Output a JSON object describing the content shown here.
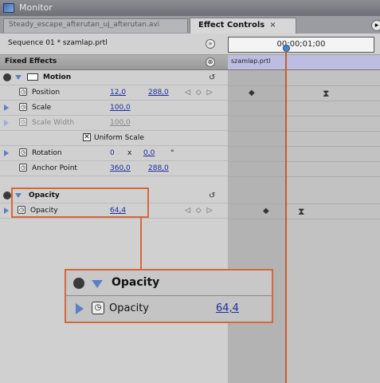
{
  "window": {
    "title": "Monitor"
  },
  "tabs": [
    {
      "label": "Steady_escape_afterutan_uj_afterutan.avi"
    },
    {
      "label": "Effect Controls",
      "close": "×"
    }
  ],
  "header": {
    "sequence": "Sequence 01 * szamlap.prtl",
    "timecode": "00;00;01;00",
    "section": "Fixed Effects",
    "clip_name": "szamlap.prtl"
  },
  "motion": {
    "title": "Motion",
    "position": {
      "label": "Position",
      "x": "12,0",
      "y": "288,0"
    },
    "scale": {
      "label": "Scale",
      "value": "100,0"
    },
    "scale_width": {
      "label": "Scale Width",
      "value": "100,0"
    },
    "uniform_scale": {
      "label": "Uniform Scale",
      "checked": true
    },
    "rotation": {
      "label": "Rotation",
      "turns": "0",
      "x": "x",
      "degrees": "0,0",
      "unit": "°"
    },
    "anchor_point": {
      "label": "Anchor Point",
      "x": "360,0",
      "y": "288,0"
    }
  },
  "opacity": {
    "title": "Opacity",
    "param": {
      "label": "Opacity",
      "value": "64,4"
    }
  },
  "callout": {
    "title": "Opacity",
    "label": "Opacity",
    "value": "64,4"
  },
  "colors": {
    "accent": "#d5683a",
    "value_link": "#1c2ea0",
    "clip_bar": "#bdbde2",
    "playhead": "#4b82d0"
  },
  "icons": [
    "app-icon",
    "fx-toggle-icon",
    "disclosure-triangle-icon",
    "stopwatch-icon",
    "reset-icon",
    "keyframe-nav-icon",
    "keyframe-diamond-icon",
    "keyframe-hourglass-icon",
    "flyout-menu-icon",
    "checkbox-icon",
    "motion-icon"
  ]
}
